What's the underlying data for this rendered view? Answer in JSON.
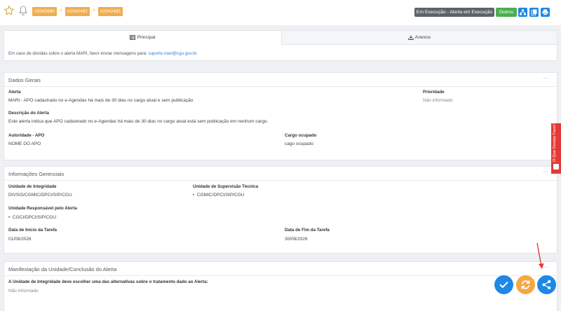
{
  "header": {
    "ids": [
      "#2065880",
      "#2042482",
      "#2042483"
    ],
    "separator": "»",
    "status_label": "Em Execução - Alerta em Execução",
    "outros_label": "Outros"
  },
  "tabs": [
    {
      "label": "Principal",
      "icon": "table-icon"
    },
    {
      "label": "Anexos",
      "icon": "download-icon"
    }
  ],
  "info": {
    "text": "Em caso de dúvidas sobre o alerta MARI, favor enviar mensagens para: ",
    "email": "suporte.mari@cgu.gov.br",
    "end": "."
  },
  "dados_gerais": {
    "title": "Dados Gerais",
    "menu": "···",
    "alerta_label": "Alerta",
    "alerta_value": "MARI - APO cadastrado no e-Agendas há mais de 30 dias no cargo atual e sem publicação",
    "prioridade_label": "Prioridade",
    "prioridade_value": "Não informado",
    "descricao_label": "Descrição do Alerta",
    "descricao_value": "Este alerta indica que APO cadastrado no e-Agendas há mais de 30 dias no cargo atual está sem publicação em nenhum cargo.",
    "autoridade_label": "Autoridade - APO",
    "autoridade_value": "NOME DO APO",
    "cargo_label": "Cargo ocupado",
    "cargo_value": "cago ocupado"
  },
  "informacoes": {
    "title": "Informações Gerenciais",
    "menu": "···",
    "unidade_integridade_label": "Unidade de Integridade",
    "unidade_integridade_value": "DIVSIS/CGMIC/DPCI/SIP/CGU",
    "unidade_supervisao_label": "Unidade de Supervisão Técnica",
    "unidade_supervisao_value": "CGMIC/DPCI/SIP/CGU",
    "unidade_responsavel_label": "Unidade Responsável pelo Alerta",
    "unidade_responsavel_value": "CGCI/DPCI/SIP/CGU",
    "bullet": "•",
    "inicio_label": "Data de Início da Tarefa",
    "inicio_value": "01/08/2026",
    "fim_label": "Data de Fim da Tarefa",
    "fim_value": "30/08/2026"
  },
  "manifestacao": {
    "title": "Manifestação da Unidade/Conclusão do Alerta",
    "menu": "···",
    "question_label": "A Unidade de Integridade deve escolher uma das alternativas sobre o tratamento dado ao Alerta:",
    "question_value": "Não informado"
  },
  "feedback": {
    "label": "O Que Deseja Fazer?"
  },
  "colors": {
    "chip": "#f0ad4e",
    "status": "#5d6468",
    "outros": "#4caf50",
    "primary": "#1e88e5",
    "fab_orange": "#f5a742",
    "feedback": "#e53935"
  }
}
